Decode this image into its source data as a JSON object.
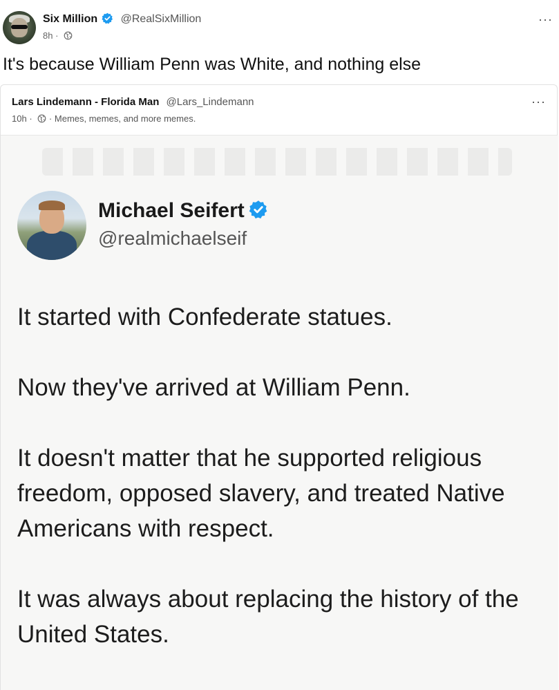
{
  "post": {
    "author_name": "Six Million",
    "author_handle": "@RealSixMillion",
    "time": "8h",
    "separator": "·",
    "more_label": "···",
    "text": "It's because William Penn was White, and nothing else"
  },
  "quote": {
    "author_name": "Lars Lindemann - Florida Man",
    "author_handle": "@Lars_Lindemann",
    "time": "10h",
    "separator": "·",
    "group": "Memes, memes, and more memes.",
    "more_label": "···"
  },
  "meme": {
    "name": "Michael Seifert",
    "handle": "@realmichaelseif",
    "paragraphs": [
      "It started with Confederate statues.",
      "Now they've arrived at William Penn.",
      "It doesn't matter that he supported religious freedom, opposed slavery, and treated Native Americans with respect.",
      "It was always about replacing the history of the United States."
    ]
  },
  "colors": {
    "verified": "#1d9bf0",
    "text": "#1a1a1a",
    "muted": "#555555"
  },
  "icons": {
    "verified": "verified-badge-icon",
    "globe": "globe-icon",
    "more": "more-options-icon"
  }
}
